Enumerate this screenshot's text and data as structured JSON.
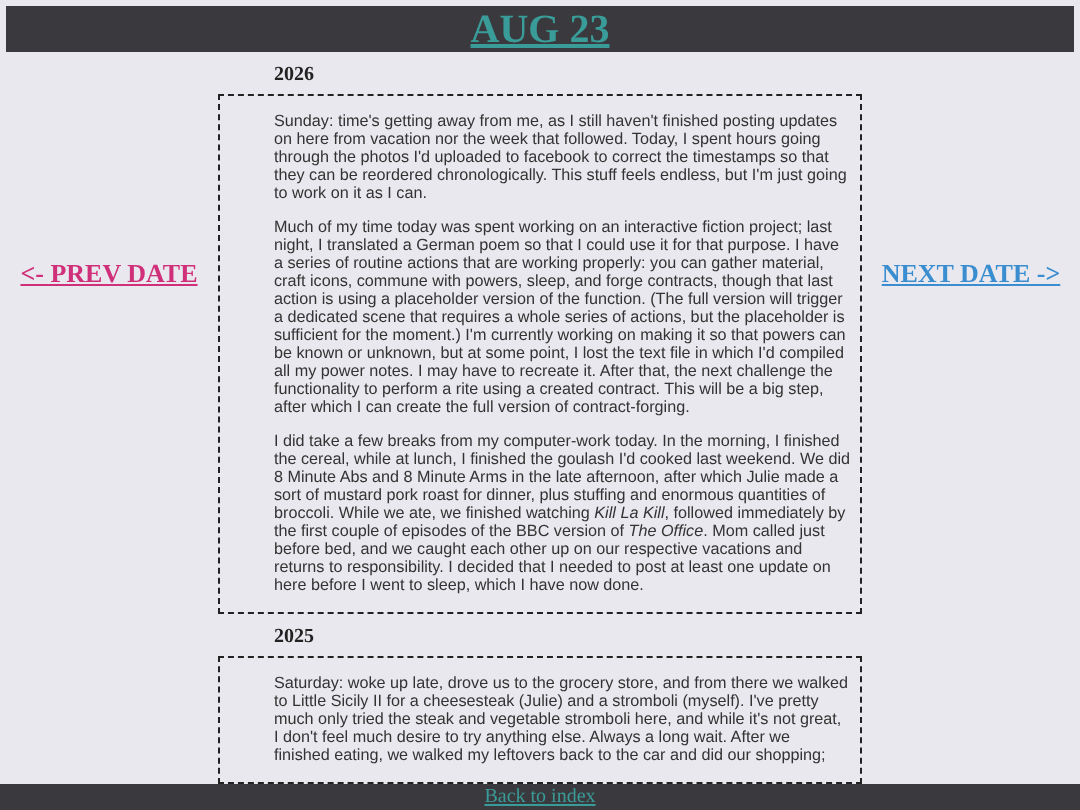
{
  "header": {
    "title": "AUG 23"
  },
  "nav": {
    "prev": "<- PREV DATE",
    "next": "NEXT DATE ->"
  },
  "entries": [
    {
      "year": "2026",
      "paragraphs": [
        "Sunday: time's getting away from me, as I still haven't finished posting updates on here from vacation nor the week that followed. Today, I spent hours going through the photos I'd uploaded to facebook to correct the timestamps so that they can be reordered chronologically. This stuff feels endless, but I'm just going to work on it as I can.",
        "Much of my time today was spent working on an interactive fiction project; last night, I translated a German poem so that I could use it for that purpose. I have a series of routine actions that are working properly: you can gather material, craft icons, commune with powers, sleep, and forge contracts, though that last action is using a placeholder version of the function. (The full version will trigger a dedicated scene that requires a whole series of actions, but the placeholder is sufficient for the moment.) I'm currently working on making it so that powers can be known or unknown, but at some point, I lost the text file in which I'd compiled all my power notes. I may have to recreate it. After that, the next challenge the functionality to perform a rite using a created contract. This will be a big step, after which I can create the full version of contract-forging.",
        "I did take a few breaks from my computer-work today. In the morning, I finished the cereal, while at lunch, I finished the goulash I'd cooked last weekend. We did 8 Minute Abs and 8 Minute Arms in the late afternoon, after which Julie made a sort of mustard pork roast for dinner, plus stuffing and enormous quantities of broccoli. While we ate, we finished watching *Kill La Kill*, followed immediately by the first couple of episodes of the BBC version of *The Office*. Mom called just before bed, and we caught each other up on our respective vacations and returns to responsibility. I decided that I needed to post at least one update on here before I went to sleep, which I have now done."
      ]
    },
    {
      "year": "2025",
      "paragraphs": [
        "Saturday: woke up late, drove us to the grocery store, and from there we walked to Little Sicily II for a cheesesteak (Julie) and a stromboli (myself). I've pretty much only tried the steak and vegetable stromboli here, and while it's not great, I don't feel much desire to try anything else. Always a long wait. After we finished eating, we walked my leftovers back to the car and did our shopping;"
      ]
    }
  ],
  "footer": {
    "link": "Back to index"
  }
}
